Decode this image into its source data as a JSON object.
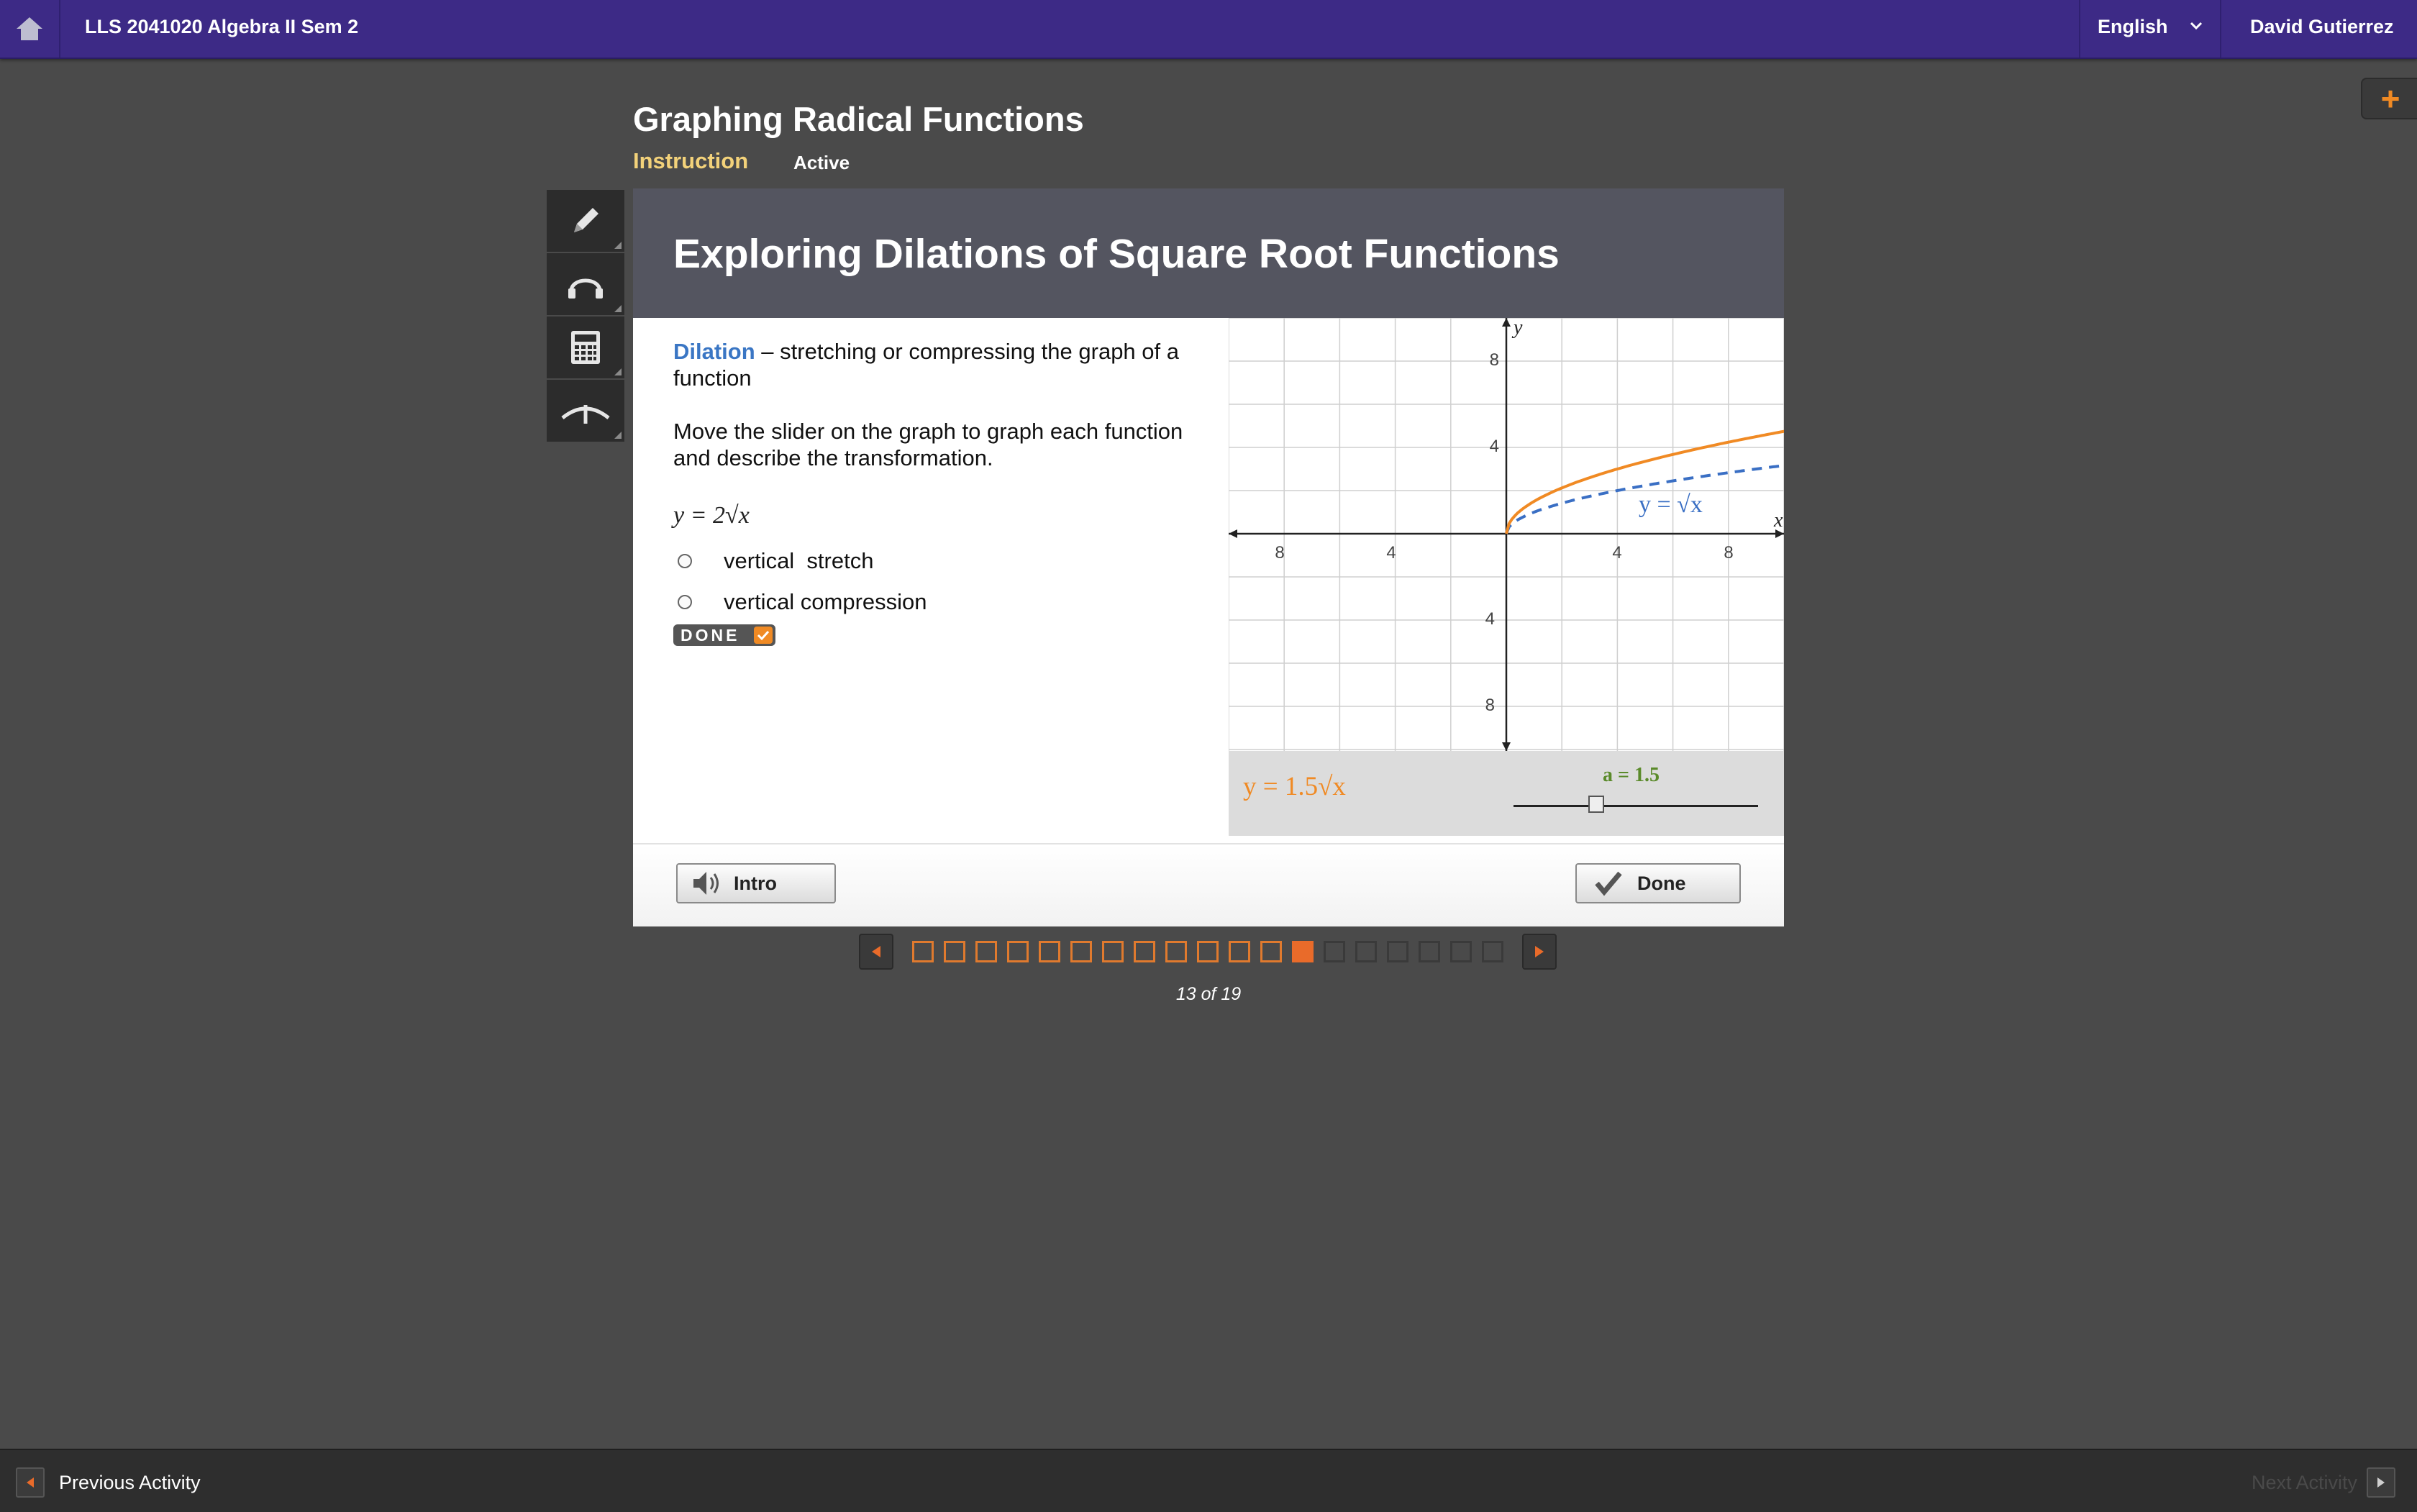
{
  "topbar": {
    "course_title": "LLS 2041020 Algebra II Sem 2",
    "language": "English",
    "user_name": "David Gutierrez"
  },
  "lesson": {
    "title": "Graphing Radical Functions",
    "type": "Instruction",
    "status": "Active"
  },
  "plus_button": "+",
  "panel": {
    "heading": "Exploring Dilations of Square Root Functions",
    "term": "Dilation",
    "definition": " – stretching or compressing the graph of a function",
    "instructions": "Move the slider on the graph to graph each function and describe the transformation.",
    "equation": "y = 2√x",
    "options": [
      "vertical  stretch",
      "vertical compression"
    ],
    "done_chip": "DONE"
  },
  "graph": {
    "x_axis_label": "x",
    "y_axis_label": "y",
    "x_ticks": [
      "8",
      "4",
      "4",
      "8"
    ],
    "y_ticks": [
      "8",
      "4",
      "4",
      "8"
    ],
    "parent_curve_label": "y = √x",
    "current_equation": "y = 1.5√x",
    "slider_label": "a = 1.5",
    "slider_value": 1.5,
    "colors": {
      "parent": "#3a6fc4",
      "dilated": "#f08a24",
      "slider_label": "#5a8a2a"
    }
  },
  "chart_data": {
    "type": "line",
    "series": [
      {
        "name": "y = √x",
        "x": [
          0,
          1,
          2,
          4,
          6,
          8,
          10
        ],
        "y": [
          0,
          1,
          1.41,
          2,
          2.45,
          2.83,
          3.16
        ]
      },
      {
        "name": "y = 1.5√x",
        "x": [
          0,
          1,
          2,
          4,
          6,
          8,
          10
        ],
        "y": [
          0,
          1.5,
          2.12,
          3,
          3.67,
          4.24,
          4.74
        ]
      }
    ],
    "xlabel": "x",
    "ylabel": "y",
    "xlim": [
      -10,
      10
    ],
    "ylim": [
      -10,
      10
    ],
    "grid": true
  },
  "footer_buttons": {
    "intro": "Intro",
    "done": "Done"
  },
  "pager": {
    "total": 19,
    "current": 13,
    "count_text": "13 of 19"
  },
  "bottombar": {
    "previous": "Previous Activity",
    "next": "Next Activity"
  }
}
